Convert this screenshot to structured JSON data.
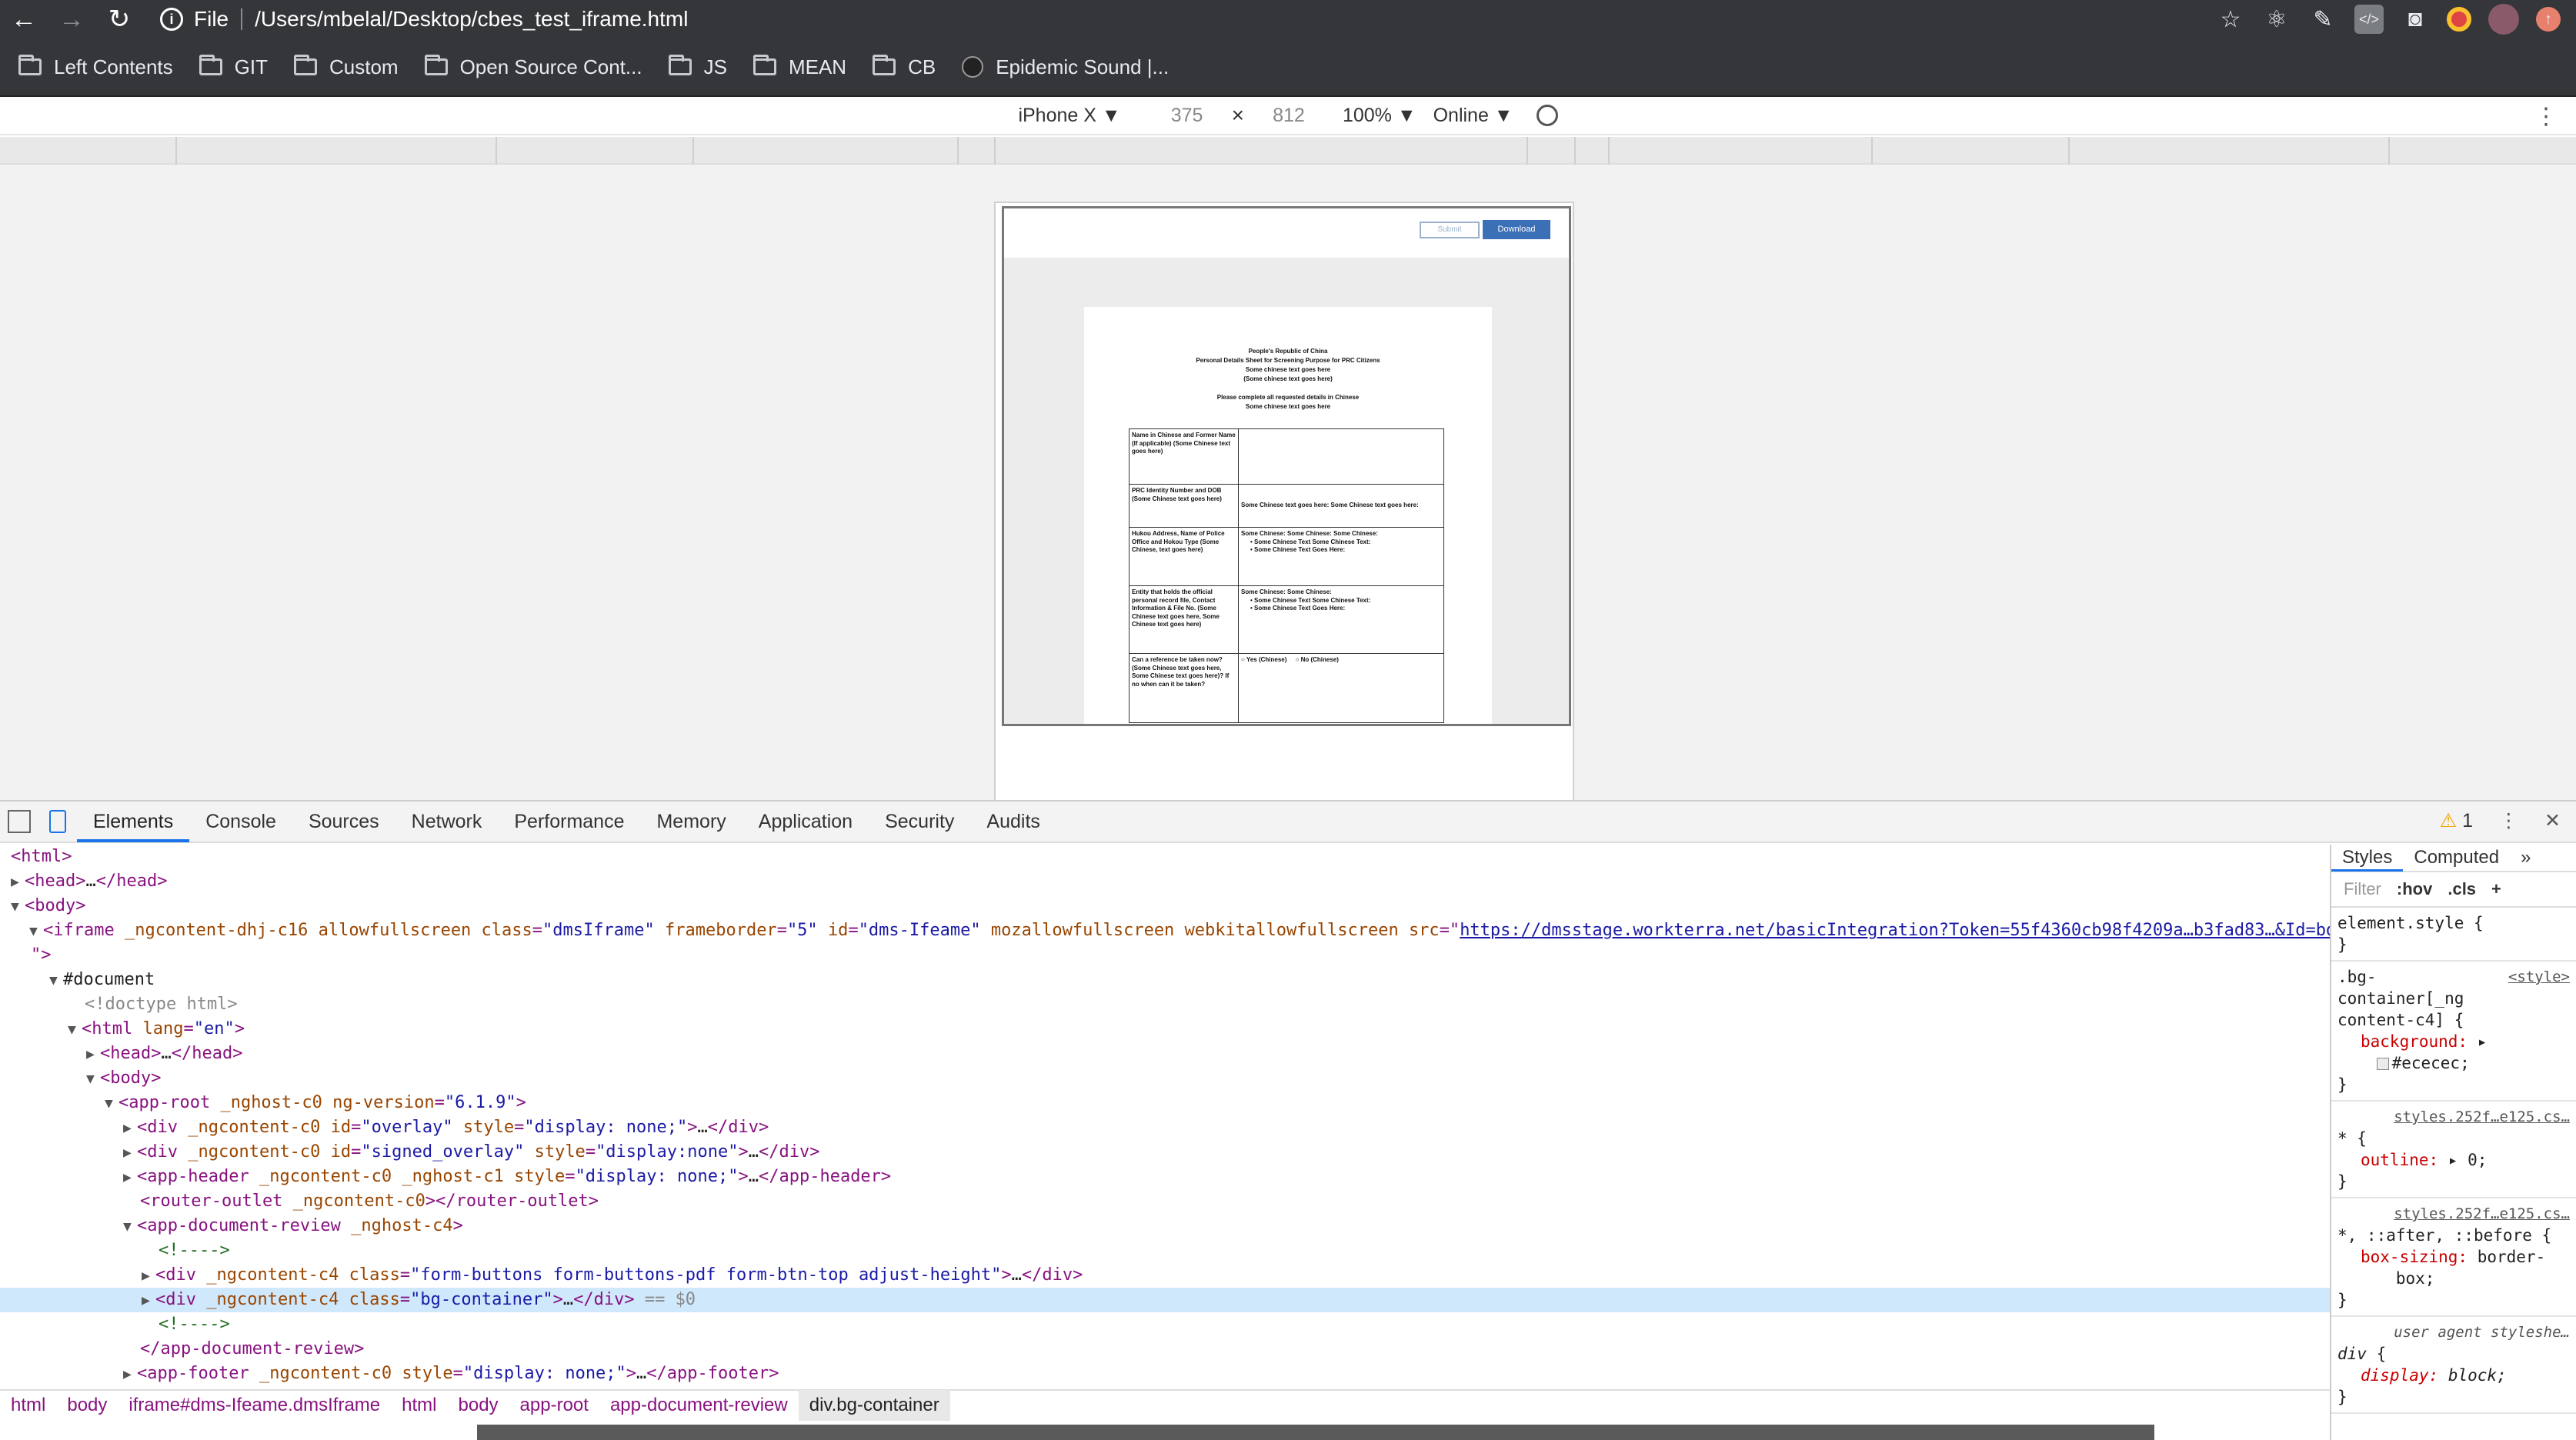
{
  "browser": {
    "address": {
      "scheme": "File",
      "url": "/Users/mbelal/Desktop/cbes_test_iframe.html"
    },
    "bookmarks": [
      "Left Contents",
      "GIT",
      "Custom",
      "Open Source Cont...",
      "JS",
      "MEAN",
      "CB",
      "Epidemic Sound |..."
    ]
  },
  "device_toolbar": {
    "device": "iPhone X ▼",
    "width": "375",
    "height": "812",
    "zoom": "100% ▼",
    "network": "Online ▼"
  },
  "page": {
    "submit": "Submit",
    "download": "Download",
    "header_lines": [
      "People's Republic of China",
      "Personal Details Sheet for Screening Purpose for PRC Citizens",
      "Some chinese text goes here",
      "(Some chinese text goes here)"
    ],
    "instruction_lines": [
      "Please complete all requested details in Chinese",
      "Some chinese text goes here"
    ],
    "rows": [
      {
        "label": "Name in Chinese and Former Name (If applicable) (Some Chinese text goes here)",
        "value": ""
      },
      {
        "label": "PRC Identity Number and DOB (Some Chinese text goes here)",
        "value": "Some Chinese text goes here: Some Chinese text goes here:"
      },
      {
        "label": "Hukou Address, Name of Police Office and Hokou Type (Some Chinese, text goes here)",
        "value": "Some Chinese: Some Chinese: Some Chinese:",
        "bullets": [
          "Some Chinese Text Some Chinese Text:",
          "Some Chinese Text Goes Here:"
        ]
      },
      {
        "label": "Entity that holds the official personal record file, Contact Information & File No. (Some Chinese text goes here, Some Chinese text goes here)",
        "value": "Some Chinese: Some Chinese:",
        "bullets": [
          "Some Chinese Text Some Chinese Text:",
          "Some Chinese Text Goes Here:"
        ]
      },
      {
        "label": "Can a reference be taken now? (Some Chinese text goes here, Some Chinese text goes here)? If no when can it be taken?",
        "yes": "Yes (Chinese)",
        "no": "No (Chinese)"
      }
    ]
  },
  "devtools": {
    "tabs": [
      "Elements",
      "Console",
      "Sources",
      "Network",
      "Performance",
      "Memory",
      "Application",
      "Security",
      "Audits"
    ],
    "warnings": "1",
    "iframe_src": "https://dmsstage.workterra.net/basicIntegration?Token=55f4360cb98f4209a…b3fad83…&Id=bd77196…",
    "breadcrumbs": [
      "html",
      "body",
      "iframe#dms-Ifeame.dmsIframe",
      "html",
      "body",
      "app-root",
      "app-document-review",
      "div.bg-container"
    ],
    "styles_tabs": [
      "Styles",
      "Computed"
    ],
    "filter_placeholder": "Filter",
    "hov": ":hov",
    "cls": ".cls"
  }
}
